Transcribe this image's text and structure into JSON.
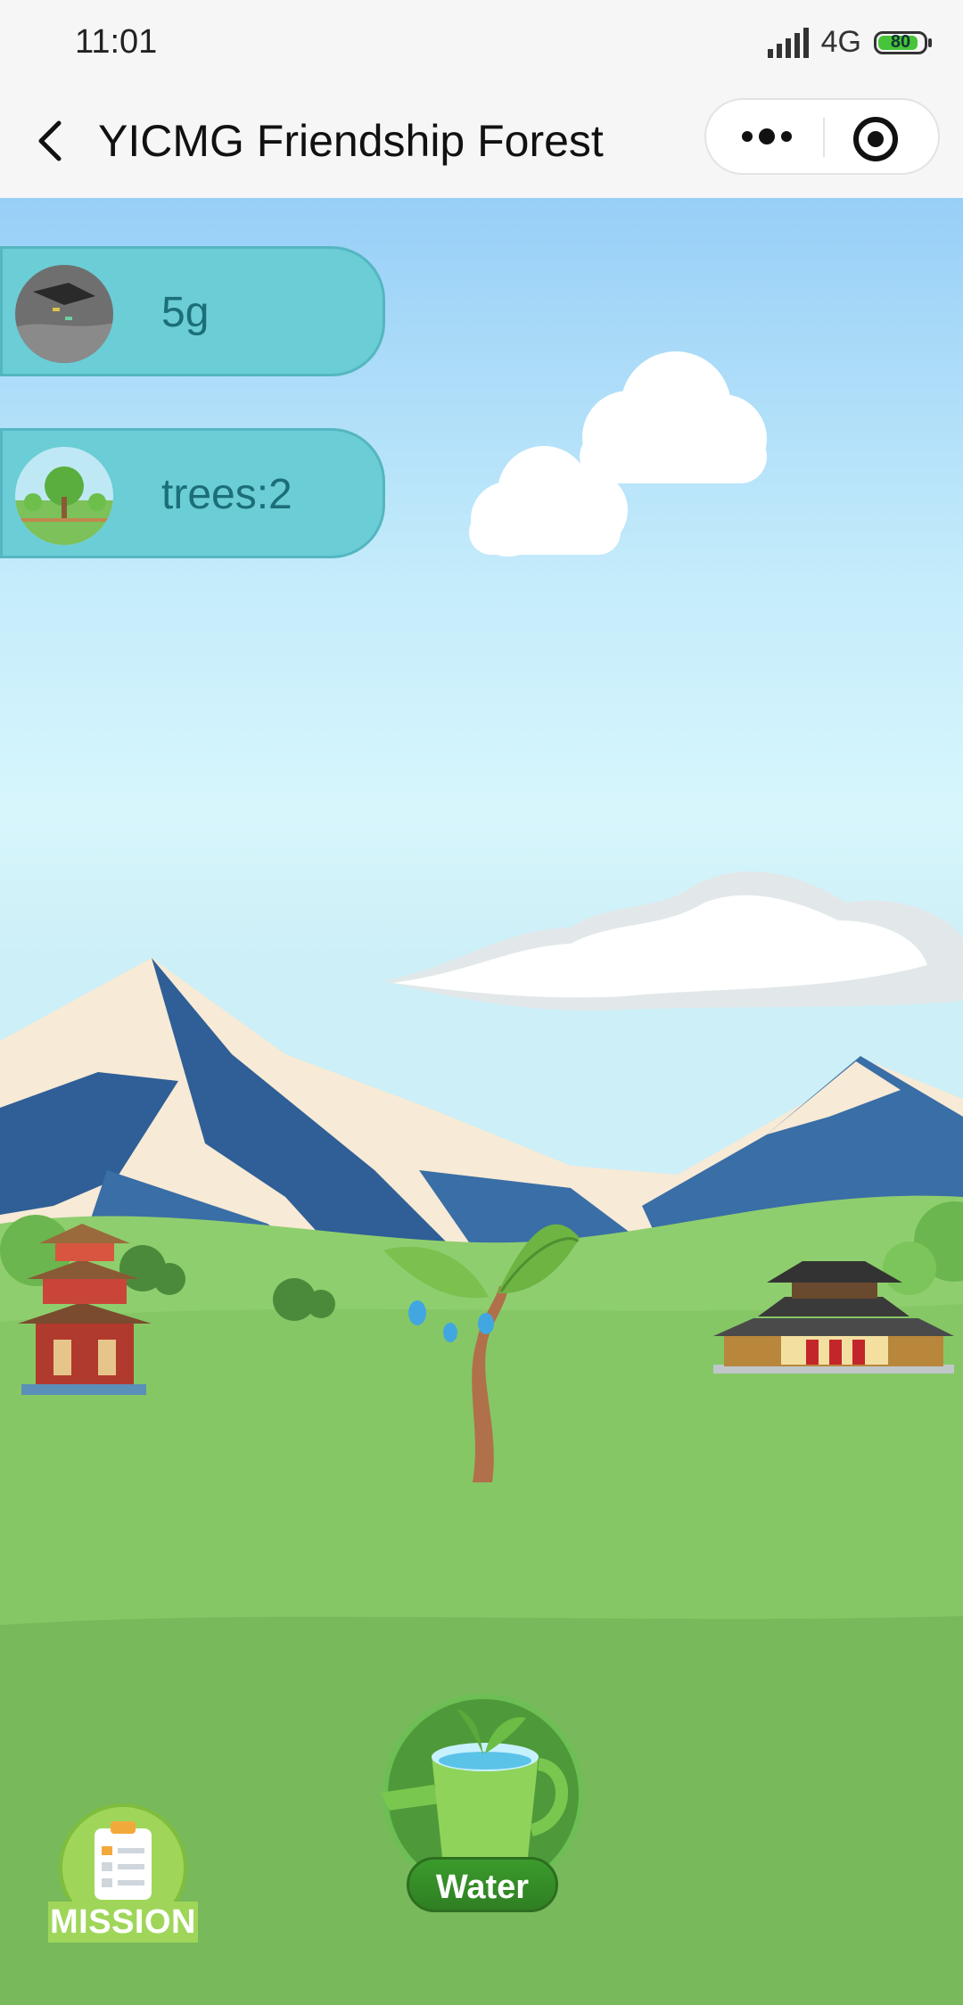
{
  "status_bar": {
    "time": "11:01",
    "network": "4G",
    "battery": "80"
  },
  "title_bar": {
    "title": "YICMG Friendship Forest"
  },
  "stats": {
    "weight": "5g",
    "trees": "trees:2"
  },
  "actions": {
    "water_label": "Water",
    "mission_label": "MISSION"
  },
  "icons": [
    "back-icon",
    "more-icon",
    "target-icon",
    "signal-icon",
    "battery-icon",
    "watering-can-icon",
    "mission-clipboard-icon"
  ],
  "colors": {
    "pill": "#6bcdd6",
    "pill_text": "#1b6e7a",
    "water_button": "#3b9b2c",
    "grass": "#7cbf61"
  }
}
